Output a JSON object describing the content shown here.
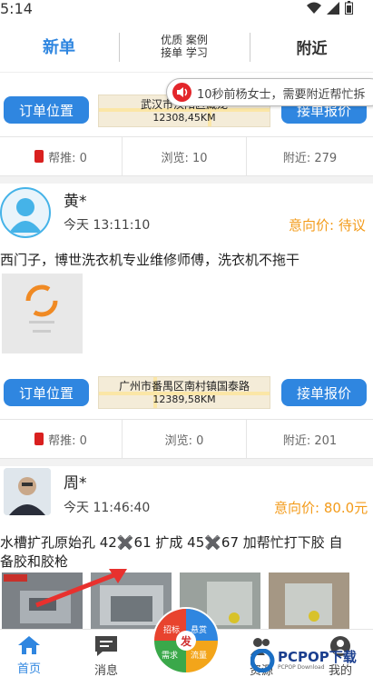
{
  "status": {
    "time": "5:14"
  },
  "tabs": {
    "new_label": "新单",
    "mid_line1": "优质 案例",
    "mid_line2": "接单 学习",
    "near_label": "附近"
  },
  "ticker": {
    "text": "10秒前杨女士，需要附近帮忙拆"
  },
  "orders": [
    {
      "location_btn": "订单位置",
      "address": "武汉市汉阳区藏龙",
      "distance": "12308,45KM",
      "quote_btn": "接单报价",
      "help": "帮推: 0",
      "views": "浏览: 10",
      "nearby": "附近: 279"
    },
    {
      "name": "黄*",
      "time": "今天 13:11:10",
      "price": "意向价: 待议",
      "description": "西门子，博世洗衣机专业维修师傅，洗衣机不拖干",
      "location_btn": "订单位置",
      "address": "广州市番禺区南村镇国泰路",
      "distance": "12389,58KM",
      "quote_btn": "接单报价",
      "help": "帮推: 0",
      "views": "浏览: 0",
      "nearby": "附近: 201"
    },
    {
      "name": "周*",
      "time": "今天 11:46:40",
      "price": "意向价: 80.0元",
      "desc_line1": "水槽扩孔原始孔 42✖️61 扩成 45✖️67 加帮忙打下胶 自",
      "desc_line2": "备胶和胶枪"
    }
  ],
  "fab": {
    "center": "发",
    "labels": [
      "招标",
      "悬赏",
      "需求",
      "流量"
    ]
  },
  "nav": [
    {
      "label": "首页",
      "icon": "home-icon"
    },
    {
      "label": "消息",
      "icon": "message-icon"
    },
    {
      "label": "资源",
      "icon": "resource-icon"
    },
    {
      "label": "我的",
      "icon": "profile-icon"
    }
  ],
  "watermark": {
    "brand": "PCPOP下载",
    "sub": "PCPOP Download"
  },
  "colors": {
    "accent": "#2f86e0",
    "price": "#f39b1a",
    "alert": "#e3262b"
  }
}
